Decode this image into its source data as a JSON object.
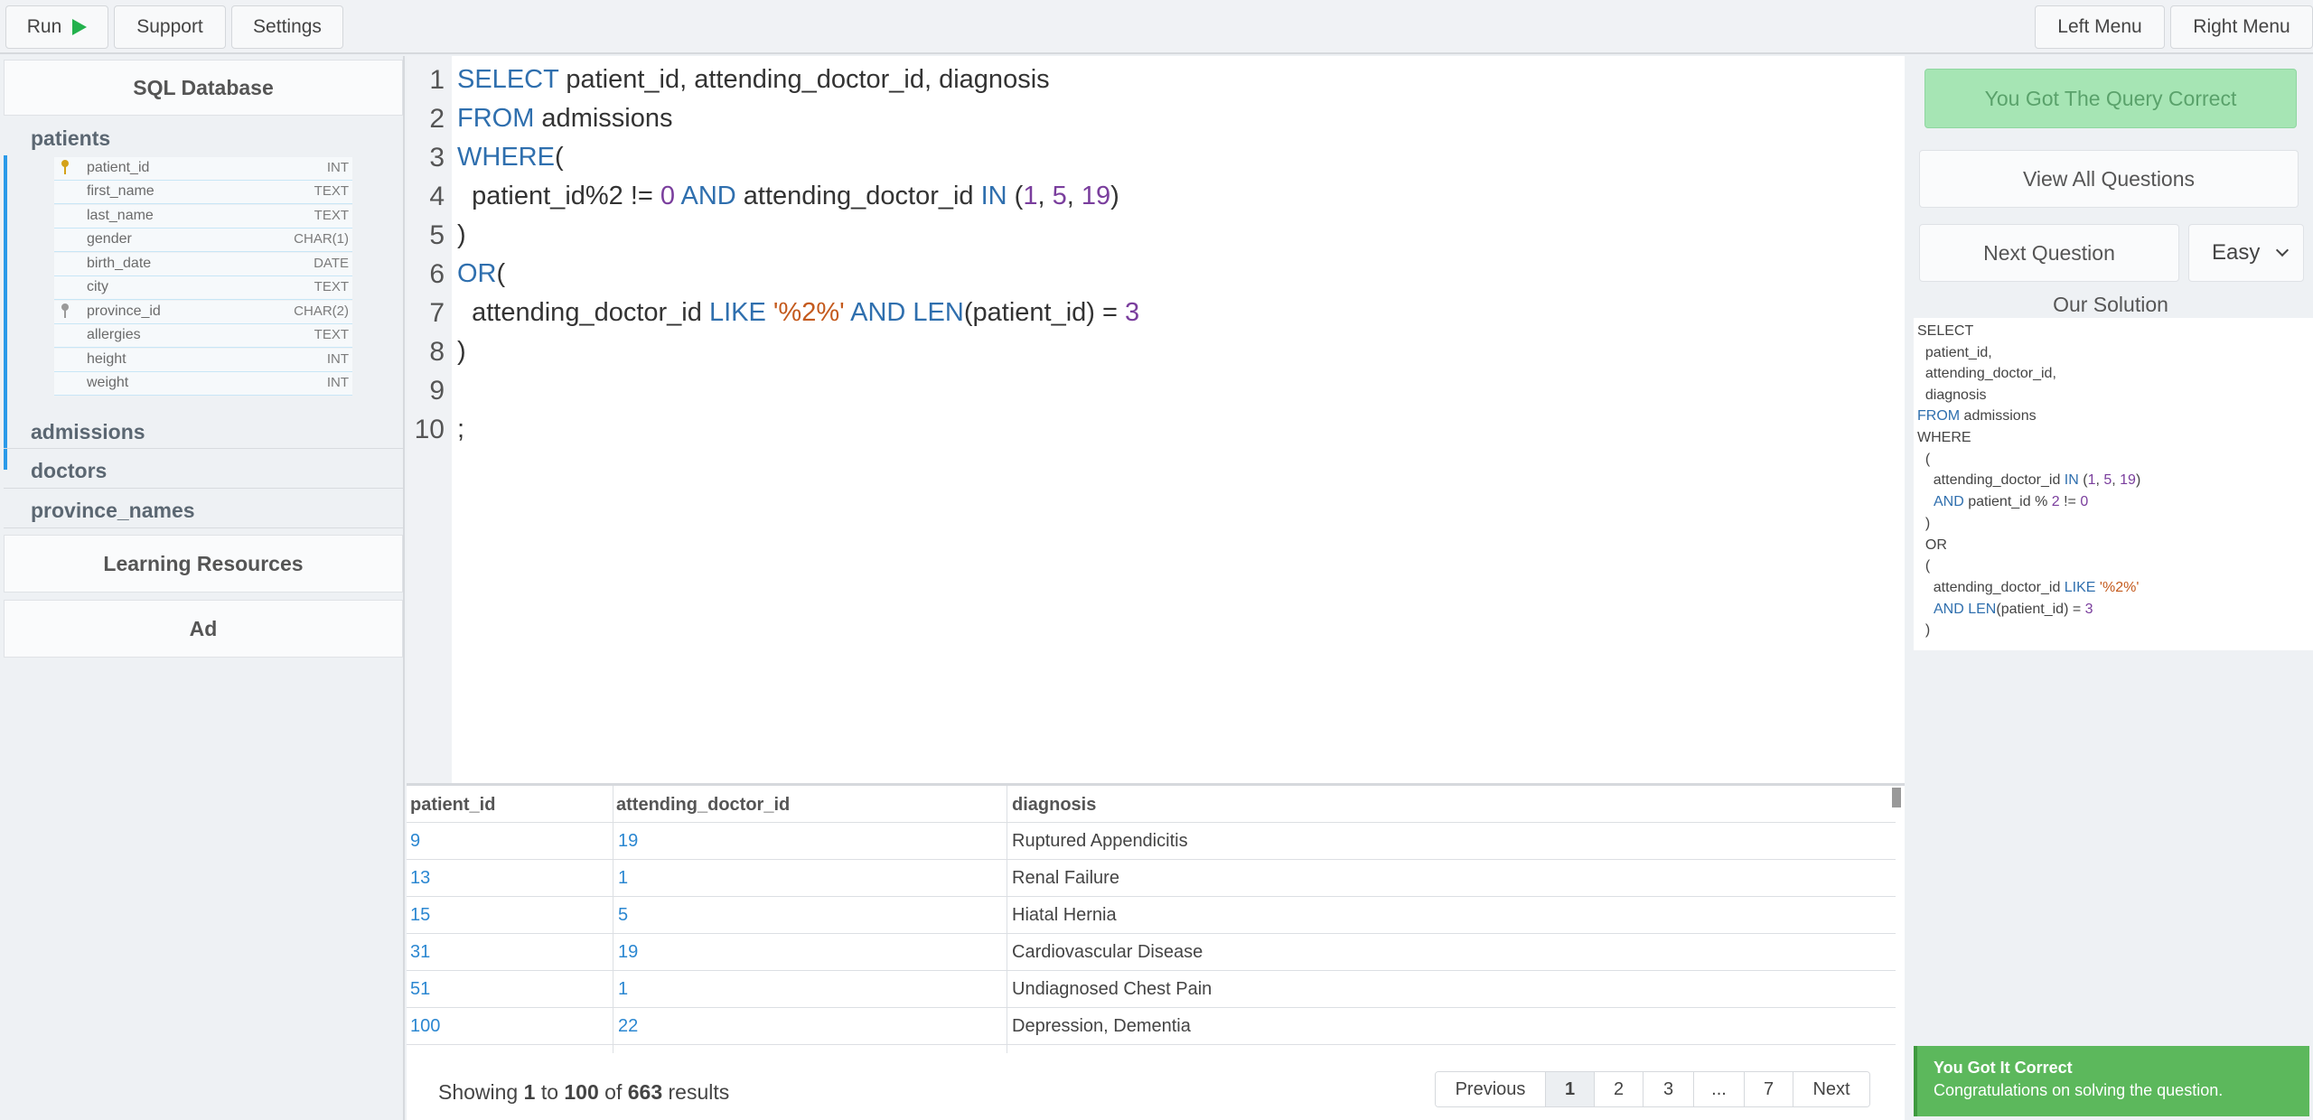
{
  "topbar": {
    "run_label": "Run",
    "support_label": "Support",
    "settings_label": "Settings",
    "left_menu_label": "Left Menu",
    "right_menu_label": "Right Menu"
  },
  "sidebar": {
    "db_title": "SQL Database",
    "tables": [
      "patients",
      "admissions",
      "doctors",
      "province_names"
    ],
    "columns": [
      {
        "name": "patient_id",
        "type": "INT",
        "key": "primary"
      },
      {
        "name": "first_name",
        "type": "TEXT",
        "key": ""
      },
      {
        "name": "last_name",
        "type": "TEXT",
        "key": ""
      },
      {
        "name": "gender",
        "type": "CHAR(1)",
        "key": ""
      },
      {
        "name": "birth_date",
        "type": "DATE",
        "key": ""
      },
      {
        "name": "city",
        "type": "TEXT",
        "key": ""
      },
      {
        "name": "province_id",
        "type": "CHAR(2)",
        "key": "foreign"
      },
      {
        "name": "allergies",
        "type": "TEXT",
        "key": ""
      },
      {
        "name": "height",
        "type": "INT",
        "key": ""
      },
      {
        "name": "weight",
        "type": "INT",
        "key": ""
      }
    ],
    "learning_resources": "Learning Resources",
    "ad": "Ad"
  },
  "editor": {
    "line_numbers": [
      "1",
      "2",
      "3",
      "4",
      "5",
      "6",
      "7",
      "8",
      "9",
      "10"
    ],
    "code": {
      "l1_kw": "SELECT",
      "l1_rest": " patient_id, attending_doctor_id, diagnosis",
      "l2_kw": "FROM",
      "l2_rest": " admissions",
      "l3_kw": "WHERE",
      "l3_rest": "(",
      "l4_a": "  patient_id%2 != ",
      "l4_n0": "0",
      "l4_b": " ",
      "l4_and": "AND",
      "l4_c": " attending_doctor_id ",
      "l4_in": "IN",
      "l4_d": " (",
      "l4_n1": "1",
      "l4_e": ", ",
      "l4_n5": "5",
      "l4_f": ", ",
      "l4_n19": "19",
      "l4_g": ")",
      "l5": ")",
      "l6_kw": "OR",
      "l6_rest": "(",
      "l7_a": "  attending_doctor_id ",
      "l7_like": "LIKE",
      "l7_b": " ",
      "l7_str": "'%2%'",
      "l7_c": " ",
      "l7_and": "AND",
      "l7_d": " ",
      "l7_len": "LEN",
      "l7_e": "(patient_id) = ",
      "l7_n3": "3",
      "l8": ")",
      "l10": ";"
    }
  },
  "results": {
    "headers": [
      "patient_id",
      "attending_doctor_id",
      "diagnosis"
    ],
    "rows": [
      [
        "9",
        "19",
        "Ruptured Appendicitis"
      ],
      [
        "13",
        "1",
        "Renal Failure"
      ],
      [
        "15",
        "5",
        "Hiatal Hernia"
      ],
      [
        "31",
        "19",
        "Cardiovascular Disease"
      ],
      [
        "51",
        "1",
        "Undiagnosed Chest Pain"
      ],
      [
        "100",
        "22",
        "Depression, Dementia"
      ]
    ],
    "showing_prefix": "Showing",
    "showing_from": "1",
    "showing_to_word": "to",
    "showing_to": "100",
    "showing_of_word": "of",
    "showing_total": "663",
    "showing_suffix": "results",
    "pagination": [
      "Previous",
      "1",
      "2",
      "3",
      "...",
      "7",
      "Next"
    ]
  },
  "right": {
    "correct_label": "You Got The Query Correct",
    "view_all_label": "View All Questions",
    "next_label": "Next Question",
    "difficulty": "Easy",
    "solution_title": "Our Solution",
    "solution": {
      "s1": "SELECT",
      "s2": "  patient_id,",
      "s3": "  attending_doctor_id,",
      "s4": "  diagnosis",
      "s5_kw": "FROM",
      "s5_rest": " admissions",
      "s6": "WHERE",
      "s7": "  (",
      "s8_a": "    attending_doctor_id ",
      "s8_in": "IN",
      "s8_b": " (",
      "s8_n1": "1",
      "s8_c": ", ",
      "s8_n5": "5",
      "s8_d": ", ",
      "s8_n19": "19",
      "s8_e": ")",
      "s9_and": "AND",
      "s9_a": " patient_id % ",
      "s9_n2": "2",
      "s9_b": " != ",
      "s9_n0": "0",
      "s10": "  )",
      "s11": "  OR",
      "s12": "  (",
      "s13_a": "    attending_doctor_id ",
      "s13_like": "LIKE",
      "s13_b": " ",
      "s13_str": "'%2%'",
      "s14_and": "AND",
      "s14_b": " ",
      "s14_len": "LEN",
      "s14_c": "(patient_id) = ",
      "s14_n3": "3",
      "s15": "  )"
    },
    "toast_title": "You Got It Correct",
    "toast_message": "Congratulations on solving the question."
  },
  "colors": {
    "keyword": "#2f6fae",
    "number": "#7a3e9d",
    "string": "#c45a1d",
    "link": "#2b87d1",
    "success": "#5cb85c",
    "accent_border": "#2b9ae8"
  }
}
